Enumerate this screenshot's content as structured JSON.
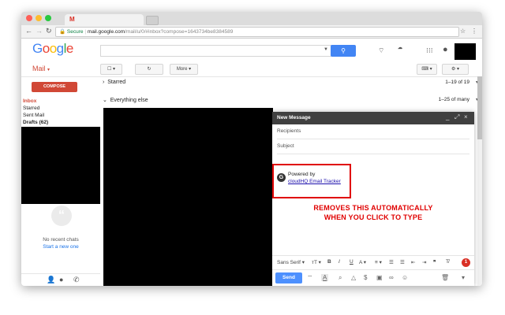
{
  "browser": {
    "tab_favicon": "M",
    "url": {
      "secure_label": "Secure",
      "host": "mail.google.com",
      "path": "/mail/u/0/#inbox?compose=1643734be8384589"
    },
    "colors": {
      "close": "#ff5f57",
      "minimize": "#febc2e",
      "maximize": "#28c840"
    }
  },
  "header": {
    "logo": "Google",
    "search_placeholder": "",
    "grid_icon": "apps-grid-icon"
  },
  "appbar": {
    "title": "Mail",
    "more_label": "More"
  },
  "sidebar": {
    "compose_label": "COMPOSE",
    "folders": [
      {
        "label": "Inbox"
      },
      {
        "label": "Starred"
      },
      {
        "label": "Sent Mail"
      },
      {
        "label": "Drafts (62)"
      }
    ],
    "chat": {
      "no_chats": "No recent chats",
      "start_new": "Start a new one"
    }
  },
  "list": {
    "sections": [
      {
        "label": "Starred",
        "count": "1–19 of 19"
      },
      {
        "label": "Everything else",
        "count": "1–25 of many"
      }
    ]
  },
  "compose_window": {
    "title": "New Message",
    "recipients_placeholder": "Recipients",
    "subject_placeholder": "Subject",
    "powered_by": "Powered by",
    "tracker_link": "cloudHQ Email Tracker",
    "annotation_line1": "REMOVES THIS AUTOMATICALLY",
    "annotation_line2": "WHEN YOU CLICK TO TYPE",
    "font_label": "Sans Serif",
    "send_label": "Send",
    "badge": "1"
  }
}
